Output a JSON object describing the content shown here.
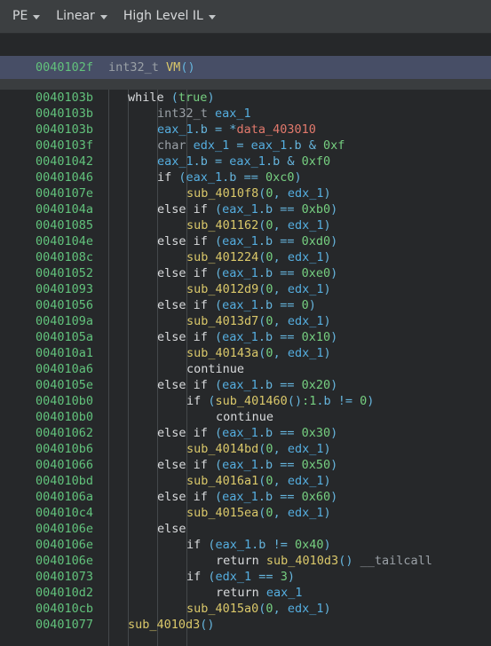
{
  "toolbar": {
    "items": [
      {
        "label": "PE",
        "caret": "chevron-down-icon"
      },
      {
        "label": "Linear",
        "caret": "chevron-down-icon"
      },
      {
        "label": "High Level IL",
        "caret": "chevron-down-icon"
      }
    ]
  },
  "function_header": {
    "address": "0040102f",
    "return_type": "int32_t",
    "name": "VM",
    "signature": "()"
  },
  "colors": {
    "toolbar_bg": "#3c3f41",
    "code_bg": "#26282a",
    "selection_bg": "#474e66",
    "address": "#62c27c",
    "keyword": "#d8dadc",
    "type": "#9aa0a6",
    "variable": "#55aee0",
    "function": "#dac86a",
    "number": "#76cf80",
    "data_ref": "#e2796c",
    "punctuation": "#66b5dd",
    "indent_guide": "#44484b"
  },
  "code_lines": [
    {
      "address": "0040103b",
      "indent": 0,
      "tokens": [
        {
          "t": "while ",
          "c": "t-kw"
        },
        {
          "t": "(",
          "c": "t-punct"
        },
        {
          "t": "true",
          "c": "t-num"
        },
        {
          "t": ")",
          "c": "t-punct"
        }
      ]
    },
    {
      "address": "0040103b",
      "indent": 1,
      "tokens": [
        {
          "t": "int32_t ",
          "c": "t-type"
        },
        {
          "t": "eax_1",
          "c": "t-var"
        }
      ]
    },
    {
      "address": "0040103b",
      "indent": 1,
      "tokens": [
        {
          "t": "eax_1",
          "c": "t-var"
        },
        {
          "t": ".b",
          "c": "t-punct"
        },
        {
          "t": " = ",
          "c": "t-punct"
        },
        {
          "t": "*",
          "c": "t-punct"
        },
        {
          "t": "data_403010",
          "c": "t-data"
        }
      ]
    },
    {
      "address": "0040103f",
      "indent": 1,
      "tokens": [
        {
          "t": "char ",
          "c": "t-type"
        },
        {
          "t": "edx_1",
          "c": "t-var"
        },
        {
          "t": " = ",
          "c": "t-punct"
        },
        {
          "t": "eax_1",
          "c": "t-var"
        },
        {
          "t": ".b",
          "c": "t-punct"
        },
        {
          "t": " & ",
          "c": "t-punct"
        },
        {
          "t": "0xf",
          "c": "t-num"
        }
      ]
    },
    {
      "address": "00401042",
      "indent": 1,
      "tokens": [
        {
          "t": "eax_1",
          "c": "t-var"
        },
        {
          "t": ".b",
          "c": "t-punct"
        },
        {
          "t": " = ",
          "c": "t-punct"
        },
        {
          "t": "eax_1",
          "c": "t-var"
        },
        {
          "t": ".b",
          "c": "t-punct"
        },
        {
          "t": " & ",
          "c": "t-punct"
        },
        {
          "t": "0xf0",
          "c": "t-num"
        }
      ]
    },
    {
      "address": "00401046",
      "indent": 1,
      "tokens": [
        {
          "t": "if ",
          "c": "t-kw"
        },
        {
          "t": "(",
          "c": "t-punct"
        },
        {
          "t": "eax_1",
          "c": "t-var"
        },
        {
          "t": ".b",
          "c": "t-punct"
        },
        {
          "t": " == ",
          "c": "t-punct"
        },
        {
          "t": "0xc0",
          "c": "t-num"
        },
        {
          "t": ")",
          "c": "t-punct"
        }
      ]
    },
    {
      "address": "0040107e",
      "indent": 2,
      "tokens": [
        {
          "t": "sub_4010f8",
          "c": "t-fn"
        },
        {
          "t": "(",
          "c": "t-punct"
        },
        {
          "t": "0",
          "c": "t-num"
        },
        {
          "t": ", ",
          "c": "t-punct"
        },
        {
          "t": "edx_1",
          "c": "t-var"
        },
        {
          "t": ")",
          "c": "t-punct"
        }
      ]
    },
    {
      "address": "0040104a",
      "indent": 1,
      "tokens": [
        {
          "t": "else if ",
          "c": "t-kw"
        },
        {
          "t": "(",
          "c": "t-punct"
        },
        {
          "t": "eax_1",
          "c": "t-var"
        },
        {
          "t": ".b",
          "c": "t-punct"
        },
        {
          "t": " == ",
          "c": "t-punct"
        },
        {
          "t": "0xb0",
          "c": "t-num"
        },
        {
          "t": ")",
          "c": "t-punct"
        }
      ]
    },
    {
      "address": "00401085",
      "indent": 2,
      "tokens": [
        {
          "t": "sub_401162",
          "c": "t-fn"
        },
        {
          "t": "(",
          "c": "t-punct"
        },
        {
          "t": "0",
          "c": "t-num"
        },
        {
          "t": ", ",
          "c": "t-punct"
        },
        {
          "t": "edx_1",
          "c": "t-var"
        },
        {
          "t": ")",
          "c": "t-punct"
        }
      ]
    },
    {
      "address": "0040104e",
      "indent": 1,
      "tokens": [
        {
          "t": "else if ",
          "c": "t-kw"
        },
        {
          "t": "(",
          "c": "t-punct"
        },
        {
          "t": "eax_1",
          "c": "t-var"
        },
        {
          "t": ".b",
          "c": "t-punct"
        },
        {
          "t": " == ",
          "c": "t-punct"
        },
        {
          "t": "0xd0",
          "c": "t-num"
        },
        {
          "t": ")",
          "c": "t-punct"
        }
      ]
    },
    {
      "address": "0040108c",
      "indent": 2,
      "tokens": [
        {
          "t": "sub_401224",
          "c": "t-fn"
        },
        {
          "t": "(",
          "c": "t-punct"
        },
        {
          "t": "0",
          "c": "t-num"
        },
        {
          "t": ", ",
          "c": "t-punct"
        },
        {
          "t": "edx_1",
          "c": "t-var"
        },
        {
          "t": ")",
          "c": "t-punct"
        }
      ]
    },
    {
      "address": "00401052",
      "indent": 1,
      "tokens": [
        {
          "t": "else if ",
          "c": "t-kw"
        },
        {
          "t": "(",
          "c": "t-punct"
        },
        {
          "t": "eax_1",
          "c": "t-var"
        },
        {
          "t": ".b",
          "c": "t-punct"
        },
        {
          "t": " == ",
          "c": "t-punct"
        },
        {
          "t": "0xe0",
          "c": "t-num"
        },
        {
          "t": ")",
          "c": "t-punct"
        }
      ]
    },
    {
      "address": "00401093",
      "indent": 2,
      "tokens": [
        {
          "t": "sub_4012d9",
          "c": "t-fn"
        },
        {
          "t": "(",
          "c": "t-punct"
        },
        {
          "t": "0",
          "c": "t-num"
        },
        {
          "t": ", ",
          "c": "t-punct"
        },
        {
          "t": "edx_1",
          "c": "t-var"
        },
        {
          "t": ")",
          "c": "t-punct"
        }
      ]
    },
    {
      "address": "00401056",
      "indent": 1,
      "tokens": [
        {
          "t": "else if ",
          "c": "t-kw"
        },
        {
          "t": "(",
          "c": "t-punct"
        },
        {
          "t": "eax_1",
          "c": "t-var"
        },
        {
          "t": ".b",
          "c": "t-punct"
        },
        {
          "t": " == ",
          "c": "t-punct"
        },
        {
          "t": "0",
          "c": "t-num"
        },
        {
          "t": ")",
          "c": "t-punct"
        }
      ]
    },
    {
      "address": "0040109a",
      "indent": 2,
      "tokens": [
        {
          "t": "sub_4013d7",
          "c": "t-fn"
        },
        {
          "t": "(",
          "c": "t-punct"
        },
        {
          "t": "0",
          "c": "t-num"
        },
        {
          "t": ", ",
          "c": "t-punct"
        },
        {
          "t": "edx_1",
          "c": "t-var"
        },
        {
          "t": ")",
          "c": "t-punct"
        }
      ]
    },
    {
      "address": "0040105a",
      "indent": 1,
      "tokens": [
        {
          "t": "else if ",
          "c": "t-kw"
        },
        {
          "t": "(",
          "c": "t-punct"
        },
        {
          "t": "eax_1",
          "c": "t-var"
        },
        {
          "t": ".b",
          "c": "t-punct"
        },
        {
          "t": " == ",
          "c": "t-punct"
        },
        {
          "t": "0x10",
          "c": "t-num"
        },
        {
          "t": ")",
          "c": "t-punct"
        }
      ]
    },
    {
      "address": "004010a1",
      "indent": 2,
      "tokens": [
        {
          "t": "sub_40143a",
          "c": "t-fn"
        },
        {
          "t": "(",
          "c": "t-punct"
        },
        {
          "t": "0",
          "c": "t-num"
        },
        {
          "t": ", ",
          "c": "t-punct"
        },
        {
          "t": "edx_1",
          "c": "t-var"
        },
        {
          "t": ")",
          "c": "t-punct"
        }
      ]
    },
    {
      "address": "004010a6",
      "indent": 2,
      "tokens": [
        {
          "t": "continue",
          "c": "t-kw"
        }
      ]
    },
    {
      "address": "0040105e",
      "indent": 1,
      "tokens": [
        {
          "t": "else if ",
          "c": "t-kw"
        },
        {
          "t": "(",
          "c": "t-punct"
        },
        {
          "t": "eax_1",
          "c": "t-var"
        },
        {
          "t": ".b",
          "c": "t-punct"
        },
        {
          "t": " == ",
          "c": "t-punct"
        },
        {
          "t": "0x20",
          "c": "t-num"
        },
        {
          "t": ")",
          "c": "t-punct"
        }
      ]
    },
    {
      "address": "004010b0",
      "indent": 2,
      "tokens": [
        {
          "t": "if ",
          "c": "t-kw"
        },
        {
          "t": "(",
          "c": "t-punct"
        },
        {
          "t": "sub_401460",
          "c": "t-fn"
        },
        {
          "t": "()",
          "c": "t-punct"
        },
        {
          "t": ":1",
          "c": "t-num"
        },
        {
          "t": ".b",
          "c": "t-punct"
        },
        {
          "t": " != ",
          "c": "t-punct"
        },
        {
          "t": "0",
          "c": "t-num"
        },
        {
          "t": ")",
          "c": "t-punct"
        }
      ]
    },
    {
      "address": "004010b0",
      "indent": 3,
      "tokens": [
        {
          "t": "continue",
          "c": "t-kw"
        }
      ]
    },
    {
      "address": "00401062",
      "indent": 1,
      "tokens": [
        {
          "t": "else if ",
          "c": "t-kw"
        },
        {
          "t": "(",
          "c": "t-punct"
        },
        {
          "t": "eax_1",
          "c": "t-var"
        },
        {
          "t": ".b",
          "c": "t-punct"
        },
        {
          "t": " == ",
          "c": "t-punct"
        },
        {
          "t": "0x30",
          "c": "t-num"
        },
        {
          "t": ")",
          "c": "t-punct"
        }
      ]
    },
    {
      "address": "004010b6",
      "indent": 2,
      "tokens": [
        {
          "t": "sub_4014bd",
          "c": "t-fn"
        },
        {
          "t": "(",
          "c": "t-punct"
        },
        {
          "t": "0",
          "c": "t-num"
        },
        {
          "t": ", ",
          "c": "t-punct"
        },
        {
          "t": "edx_1",
          "c": "t-var"
        },
        {
          "t": ")",
          "c": "t-punct"
        }
      ]
    },
    {
      "address": "00401066",
      "indent": 1,
      "tokens": [
        {
          "t": "else if ",
          "c": "t-kw"
        },
        {
          "t": "(",
          "c": "t-punct"
        },
        {
          "t": "eax_1",
          "c": "t-var"
        },
        {
          "t": ".b",
          "c": "t-punct"
        },
        {
          "t": " == ",
          "c": "t-punct"
        },
        {
          "t": "0x50",
          "c": "t-num"
        },
        {
          "t": ")",
          "c": "t-punct"
        }
      ]
    },
    {
      "address": "004010bd",
      "indent": 2,
      "tokens": [
        {
          "t": "sub_4016a1",
          "c": "t-fn"
        },
        {
          "t": "(",
          "c": "t-punct"
        },
        {
          "t": "0",
          "c": "t-num"
        },
        {
          "t": ", ",
          "c": "t-punct"
        },
        {
          "t": "edx_1",
          "c": "t-var"
        },
        {
          "t": ")",
          "c": "t-punct"
        }
      ]
    },
    {
      "address": "0040106a",
      "indent": 1,
      "tokens": [
        {
          "t": "else if ",
          "c": "t-kw"
        },
        {
          "t": "(",
          "c": "t-punct"
        },
        {
          "t": "eax_1",
          "c": "t-var"
        },
        {
          "t": ".b",
          "c": "t-punct"
        },
        {
          "t": " == ",
          "c": "t-punct"
        },
        {
          "t": "0x60",
          "c": "t-num"
        },
        {
          "t": ")",
          "c": "t-punct"
        }
      ]
    },
    {
      "address": "004010c4",
      "indent": 2,
      "tokens": [
        {
          "t": "sub_4015ea",
          "c": "t-fn"
        },
        {
          "t": "(",
          "c": "t-punct"
        },
        {
          "t": "0",
          "c": "t-num"
        },
        {
          "t": ", ",
          "c": "t-punct"
        },
        {
          "t": "edx_1",
          "c": "t-var"
        },
        {
          "t": ")",
          "c": "t-punct"
        }
      ]
    },
    {
      "address": "0040106e",
      "indent": 1,
      "tokens": [
        {
          "t": "else",
          "c": "t-kw"
        }
      ]
    },
    {
      "address": "0040106e",
      "indent": 2,
      "tokens": [
        {
          "t": "if ",
          "c": "t-kw"
        },
        {
          "t": "(",
          "c": "t-punct"
        },
        {
          "t": "eax_1",
          "c": "t-var"
        },
        {
          "t": ".b",
          "c": "t-punct"
        },
        {
          "t": " != ",
          "c": "t-punct"
        },
        {
          "t": "0x40",
          "c": "t-num"
        },
        {
          "t": ")",
          "c": "t-punct"
        }
      ]
    },
    {
      "address": "0040106e",
      "indent": 3,
      "tokens": [
        {
          "t": "return ",
          "c": "t-kw"
        },
        {
          "t": "sub_4010d3",
          "c": "t-fn"
        },
        {
          "t": "()",
          "c": "t-punct"
        },
        {
          "t": " __tailcall",
          "c": "t-type"
        }
      ]
    },
    {
      "address": "00401073",
      "indent": 2,
      "tokens": [
        {
          "t": "if ",
          "c": "t-kw"
        },
        {
          "t": "(",
          "c": "t-punct"
        },
        {
          "t": "edx_1",
          "c": "t-var"
        },
        {
          "t": " == ",
          "c": "t-punct"
        },
        {
          "t": "3",
          "c": "t-num"
        },
        {
          "t": ")",
          "c": "t-punct"
        }
      ]
    },
    {
      "address": "004010d2",
      "indent": 3,
      "tokens": [
        {
          "t": "return ",
          "c": "t-kw"
        },
        {
          "t": "eax_1",
          "c": "t-var"
        }
      ]
    },
    {
      "address": "004010cb",
      "indent": 2,
      "tokens": [
        {
          "t": "sub_4015a0",
          "c": "t-fn"
        },
        {
          "t": "(",
          "c": "t-punct"
        },
        {
          "t": "0",
          "c": "t-num"
        },
        {
          "t": ", ",
          "c": "t-punct"
        },
        {
          "t": "edx_1",
          "c": "t-var"
        },
        {
          "t": ")",
          "c": "t-punct"
        }
      ]
    },
    {
      "address": "00401077",
      "indent": 0,
      "tokens": [
        {
          "t": "sub_4010d3",
          "c": "t-fn"
        },
        {
          "t": "()",
          "c": "t-punct"
        }
      ]
    }
  ]
}
